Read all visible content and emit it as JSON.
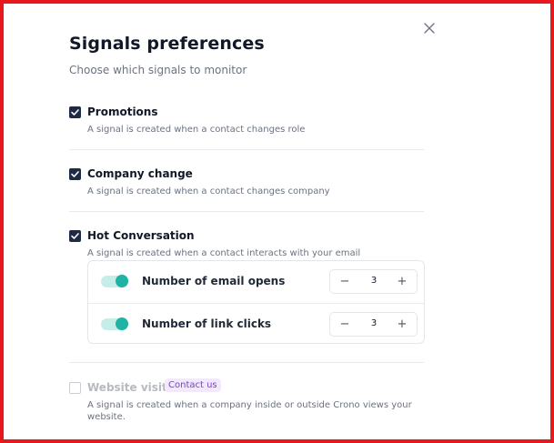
{
  "dialog": {
    "title": "Signals preferences",
    "subtitle": "Choose which signals to monitor",
    "close_icon": "close-icon"
  },
  "signals": [
    {
      "title": "Promotions",
      "description": "A signal is created when a contact changes role",
      "checked": true
    },
    {
      "title": "Company change",
      "description": "A signal is created when a contact changes company",
      "checked": true
    },
    {
      "title": "Hot Conversation",
      "description": "A signal is created when a contact interacts with your email",
      "checked": true,
      "options": [
        {
          "label": "Number of email opens",
          "enabled": true,
          "value": "3",
          "minus": "−",
          "plus": "+"
        },
        {
          "label": "Number of link clicks",
          "enabled": true,
          "value": "3",
          "minus": "−",
          "plus": "+"
        }
      ]
    },
    {
      "title": "Website visit",
      "badge": "Contact us",
      "description": "A signal is created when a company inside or outside Crono views your website.",
      "checked": false,
      "disabled": true
    }
  ],
  "colors": {
    "frame": "#e8191c",
    "checkbox": "#1f2a44",
    "toggle_track": "#c6eee9",
    "toggle_knob": "#1fb3a3",
    "badge_bg": "#f2e9fd",
    "badge_text": "#7b3fd0"
  }
}
